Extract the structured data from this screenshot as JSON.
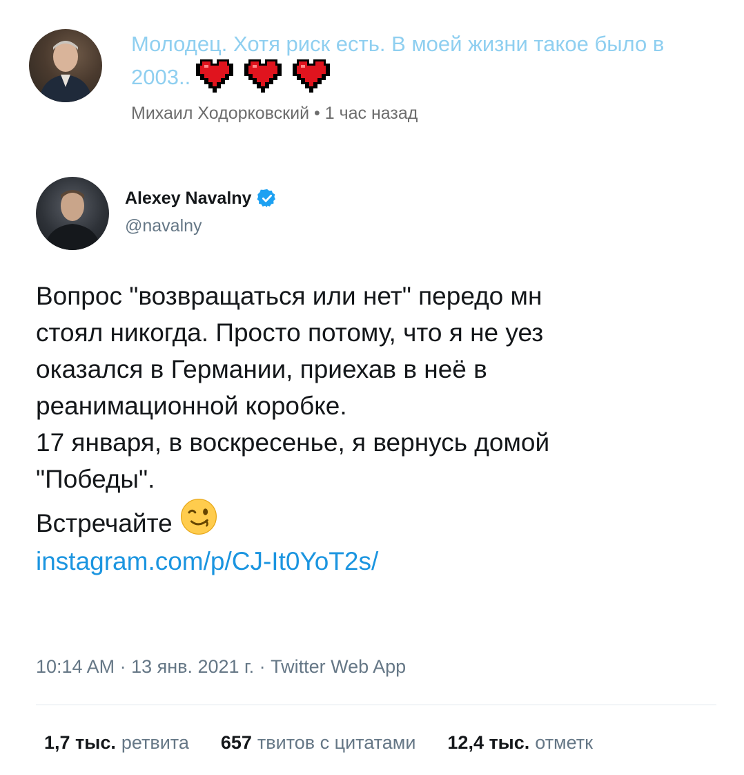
{
  "comment": {
    "text": "Молодец. Хотя риск есть. В моей жизни такое было в 2003..",
    "author": "Михаил Ходорковский",
    "separator": "•",
    "time": "1 час назад"
  },
  "tweet": {
    "name": "Alexey Navalny",
    "handle": "@navalny",
    "body_lines": [
      "Вопрос \"возвращаться или нет\" передо мн",
      "стоял никогда. Просто потому, что я не уез",
      "оказался в Германии, приехав в неё в",
      "реанимационной коробке.",
      "17 января, в воскресенье, я вернусь домой",
      "\"Победы\".",
      "Встречайте"
    ],
    "link": "instagram.com/p/CJ-It0YoT2s/",
    "meta": "10:14 AM · 13 янв. 2021 г. · Twitter Web App",
    "stats": [
      {
        "num": "1,7 тыс.",
        "label": "ретвита"
      },
      {
        "num": "657",
        "label": "твитов с цитатами"
      },
      {
        "num": "12,4 тыс.",
        "label": "отметк"
      }
    ]
  },
  "colors": {
    "comment_text": "#8fcff0",
    "link": "#1b95e0",
    "verified": "#1da1f2",
    "heart": "#e0141e"
  },
  "icons": {
    "hearts": "pixel-heart-icon",
    "verified": "verified-badge-icon",
    "emoji": "winking-face-icon"
  }
}
